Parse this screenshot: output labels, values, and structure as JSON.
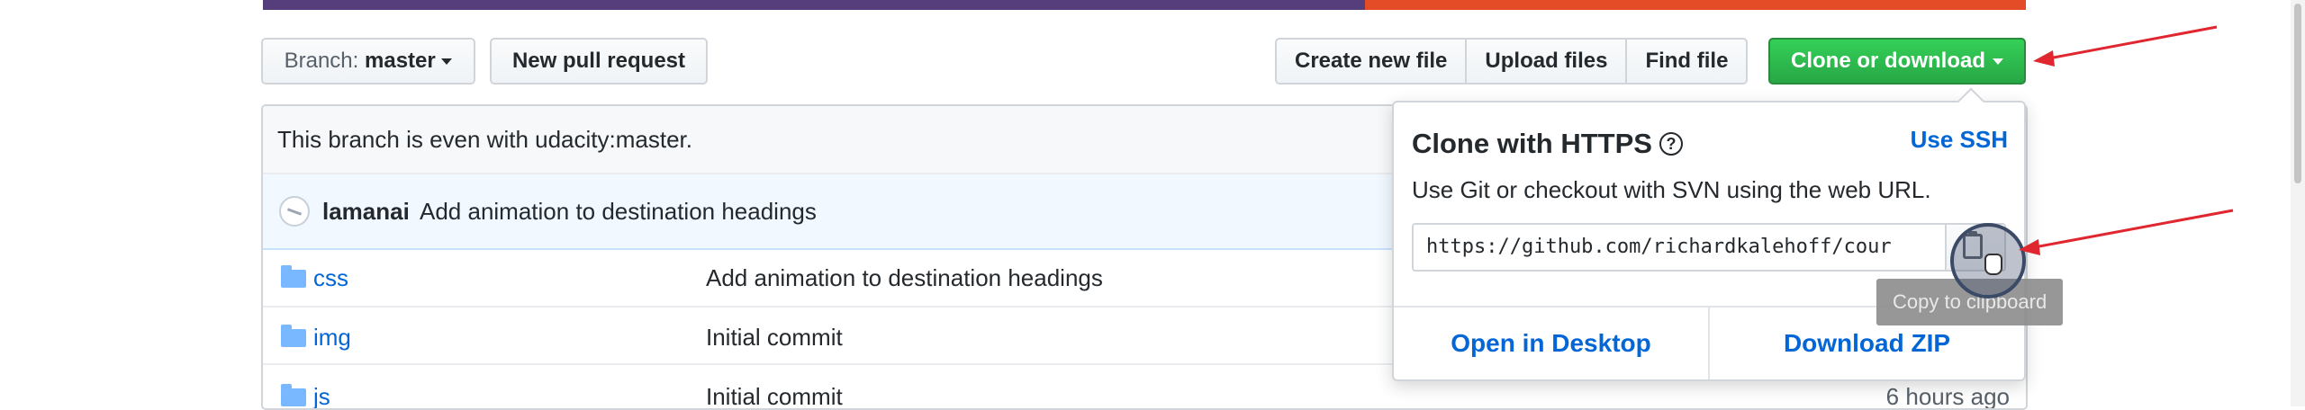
{
  "colors": {
    "lang_primary": "#563d7c",
    "lang_secondary": "#e34c26",
    "green_button": "#28a745",
    "link_blue": "#0366d6",
    "annotation_red": "#e0262f"
  },
  "toolbar": {
    "branch_prefix": "Branch: ",
    "branch_name": "master",
    "new_pr": "New pull request",
    "create_file": "Create new file",
    "upload_files": "Upload files",
    "find_file": "Find file",
    "clone_download": "Clone or download"
  },
  "status": {
    "text": "This branch is even with udacity:master."
  },
  "latest_commit": {
    "author": "lamanai",
    "message": "Add animation to destination headings"
  },
  "files": [
    {
      "icon": "folder-icon",
      "name": "css",
      "message": "Add animation to destination headings",
      "age": ""
    },
    {
      "icon": "folder-icon",
      "name": "img",
      "message": "Initial commit",
      "age": ""
    },
    {
      "icon": "folder-icon",
      "name": "js",
      "message": "Initial commit",
      "age": "6 hours ago"
    }
  ],
  "clone_popover": {
    "title": "Clone with HTTPS",
    "help_glyph": "?",
    "use_ssh": "Use SSH",
    "description": "Use Git or checkout with SVN using the web URL.",
    "url": "https://github.com/richardkalehoff/cour",
    "open_desktop": "Open in Desktop",
    "download_zip": "Download ZIP",
    "tooltip": "Copy to clipboard"
  }
}
